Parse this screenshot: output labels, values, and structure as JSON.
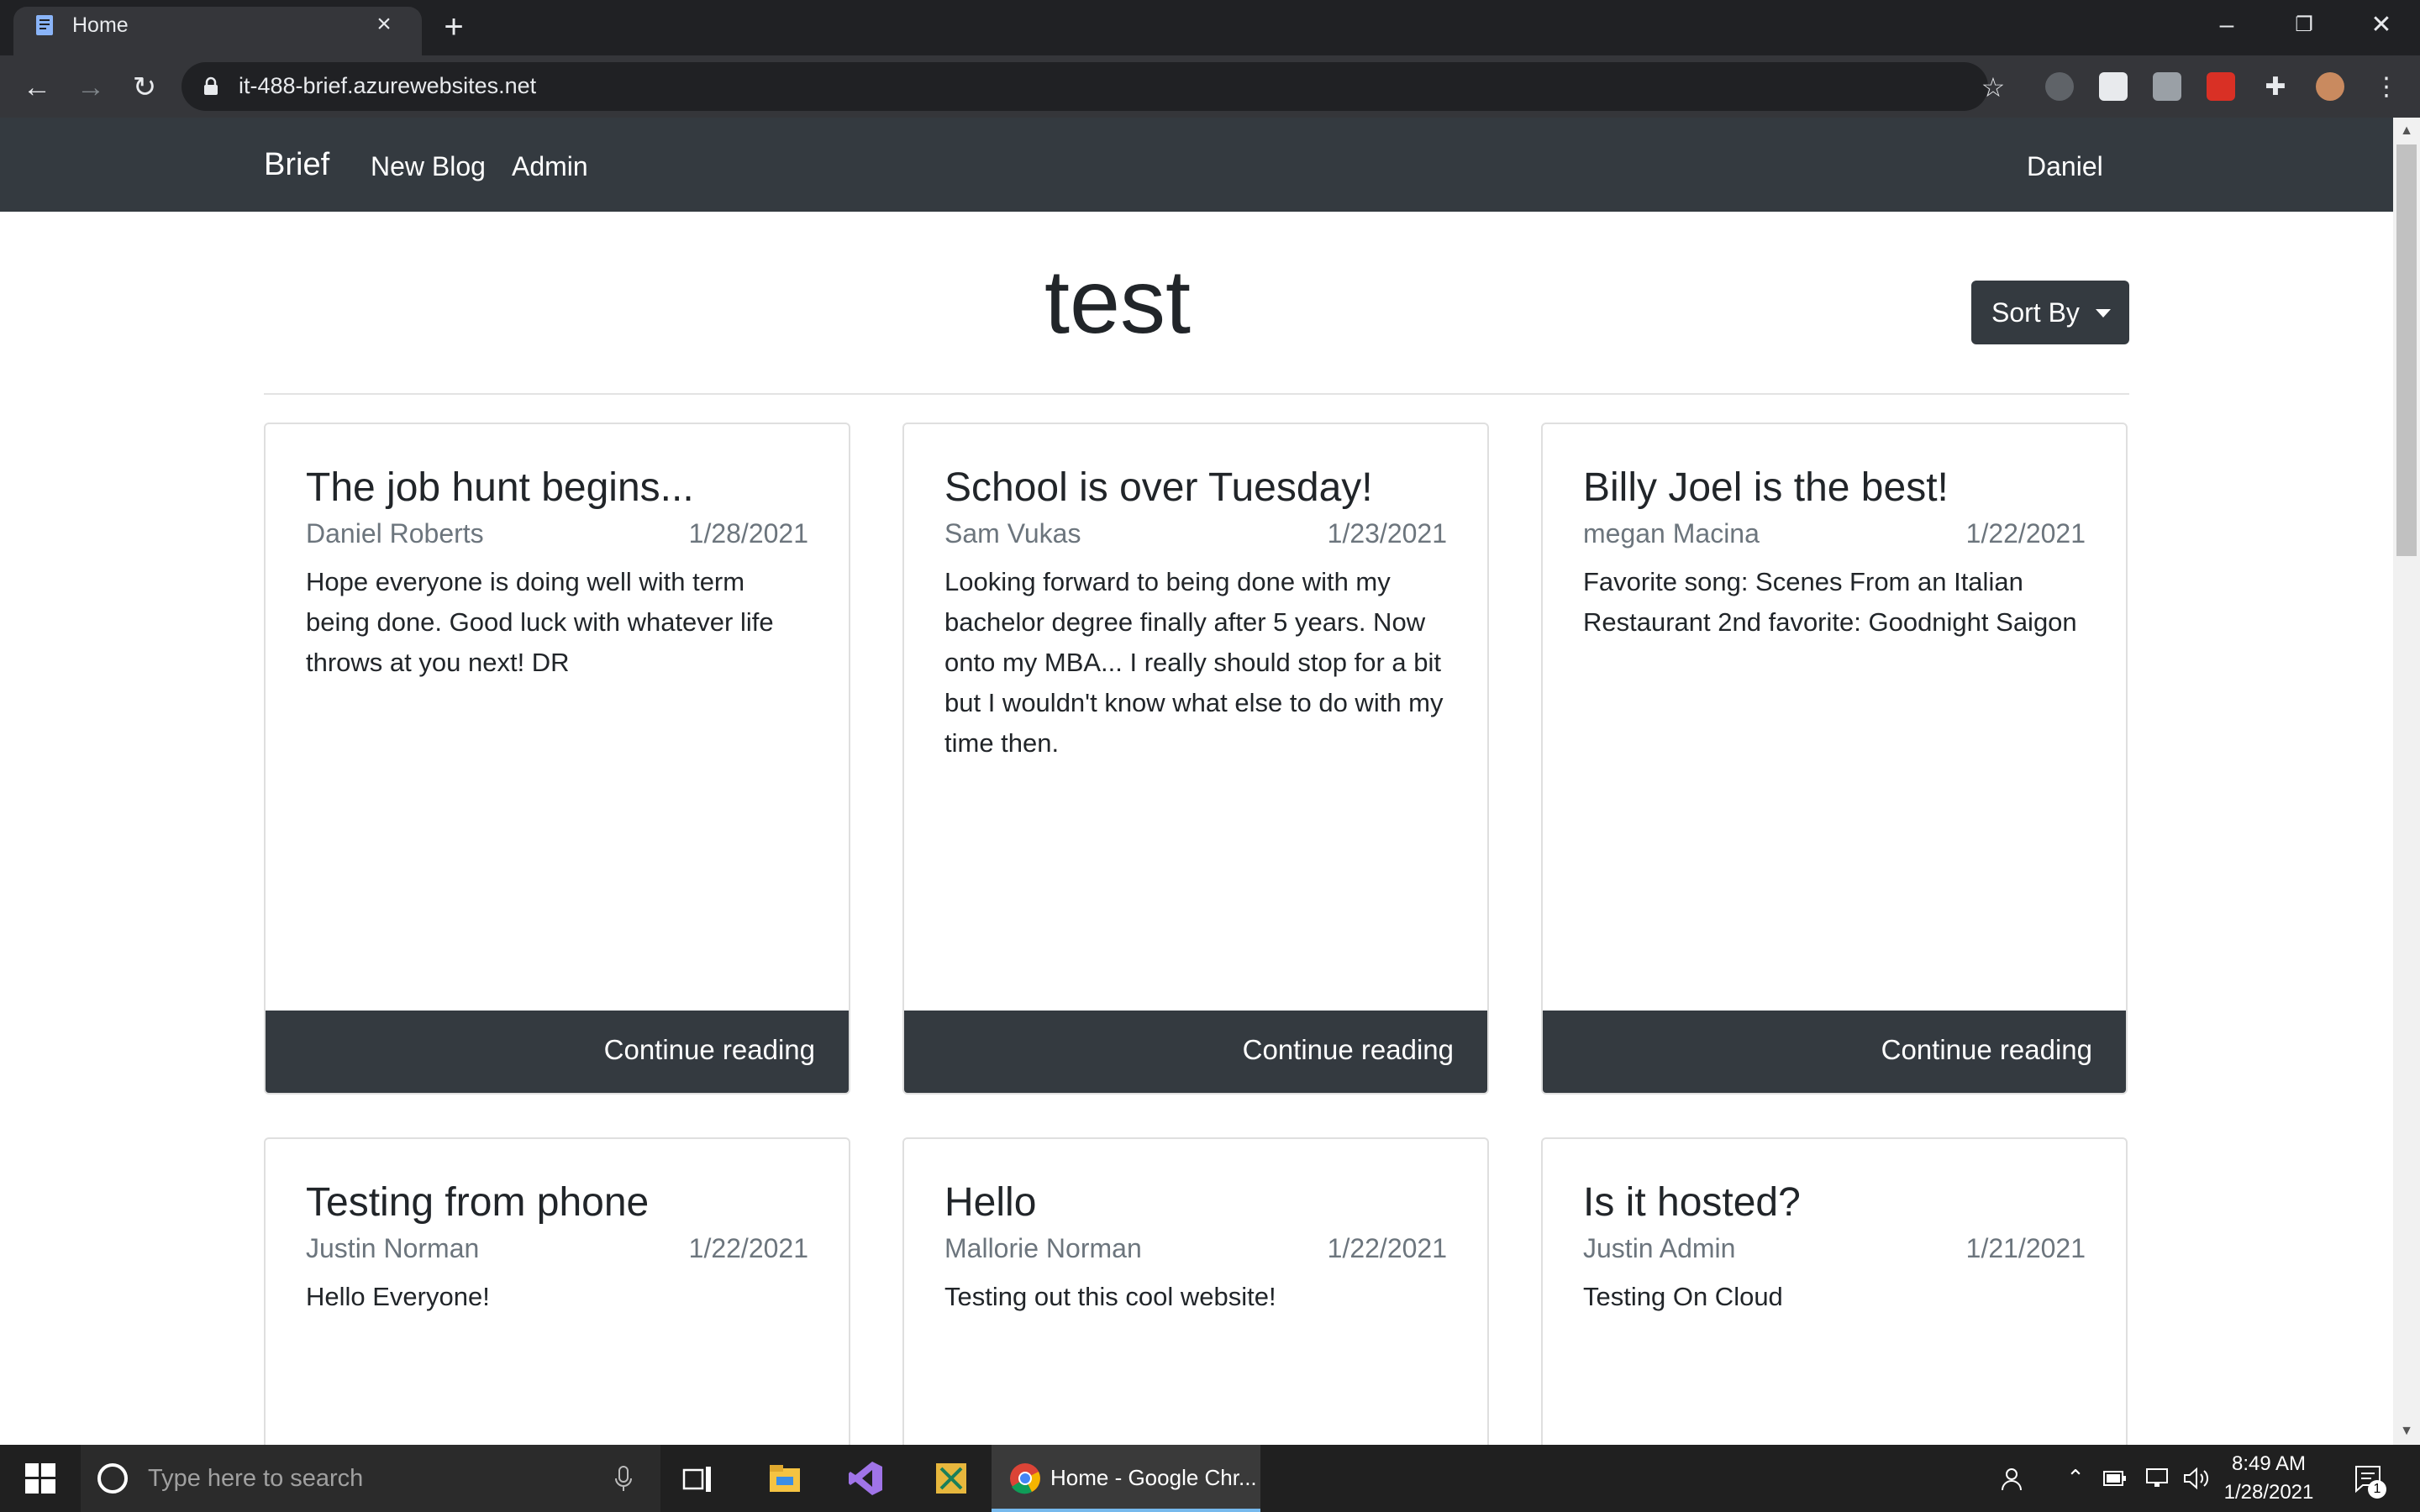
{
  "browser": {
    "tab_title": "Home",
    "url": "it-488-brief.azurewebsites.net"
  },
  "navbar": {
    "brand": "Brief",
    "links": [
      "New Blog",
      "Admin"
    ],
    "user": "Daniel"
  },
  "page": {
    "title": "test",
    "sort_label": "Sort By"
  },
  "posts": [
    {
      "title": "The job hunt begins...",
      "author": "Daniel Roberts",
      "date": "1/28/2021",
      "body": "Hope everyone is doing well with term being done. Good luck with whatever life throws at you next! DR",
      "cta": "Continue reading"
    },
    {
      "title": "School is over Tuesday!",
      "author": "Sam Vukas",
      "date": "1/23/2021",
      "body": "Looking forward to being done with my bachelor degree finally after 5 years. Now onto my MBA... I really should stop for a bit but I wouldn't know what else to do with my time then.",
      "cta": "Continue reading"
    },
    {
      "title": "Billy Joel is the best!",
      "author": "megan Macina",
      "date": "1/22/2021",
      "body": "Favorite song: Scenes From an Italian Restaurant 2nd favorite: Goodnight Saigon",
      "cta": "Continue reading"
    },
    {
      "title": "Testing from phone",
      "author": "Justin Norman",
      "date": "1/22/2021",
      "body": "Hello Everyone!"
    },
    {
      "title": "Hello",
      "author": "Mallorie Norman",
      "date": "1/22/2021",
      "body": "Testing out this cool website!"
    },
    {
      "title": "Is it hosted?",
      "author": "Justin Admin",
      "date": "1/21/2021",
      "body": "Testing On Cloud"
    }
  ],
  "taskbar": {
    "search_placeholder": "Type here to search",
    "active_app": "Home - Google Chr...",
    "time": "8:49 AM",
    "date": "1/28/2021",
    "notification_count": "1"
  },
  "colors": {
    "navbar": "#343a40",
    "browser_dark": "#202124",
    "taskbar": "#202020"
  }
}
